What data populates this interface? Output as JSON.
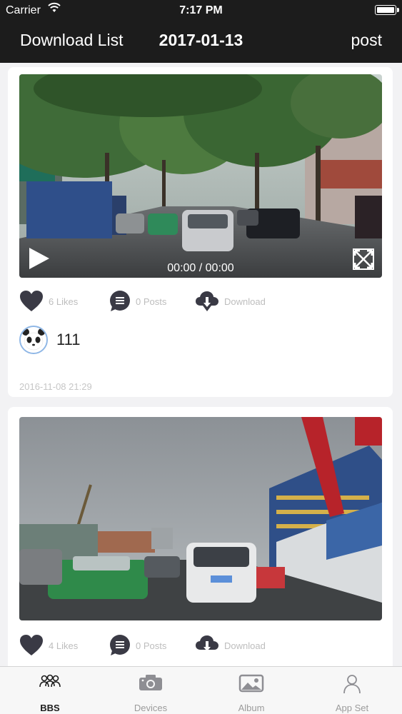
{
  "status": {
    "carrier": "Carrier",
    "time": "7:17 PM"
  },
  "nav": {
    "left": "Download List",
    "title": "2017-01-13",
    "right": "post"
  },
  "posts": [
    {
      "video_time": "00:00 / 00:00",
      "likes": "6 Likes",
      "posts": "0 Posts",
      "download": "Download",
      "username": "111",
      "date": "2016-11-08 21:29"
    },
    {
      "likes": "4 Likes",
      "posts": "0 Posts",
      "download": "Download"
    }
  ],
  "tabs": [
    {
      "label": "BBS",
      "icon": "people-icon",
      "active": true
    },
    {
      "label": "Devices",
      "icon": "camera-icon",
      "active": false
    },
    {
      "label": "Album",
      "icon": "picture-icon",
      "active": false
    },
    {
      "label": "App Set",
      "icon": "person-icon",
      "active": false
    }
  ],
  "colors": {
    "navbar": "#1c1c1c",
    "background": "#f2f2f4",
    "icon_dark": "#3a3a45",
    "muted_text": "#bdbdbd"
  }
}
